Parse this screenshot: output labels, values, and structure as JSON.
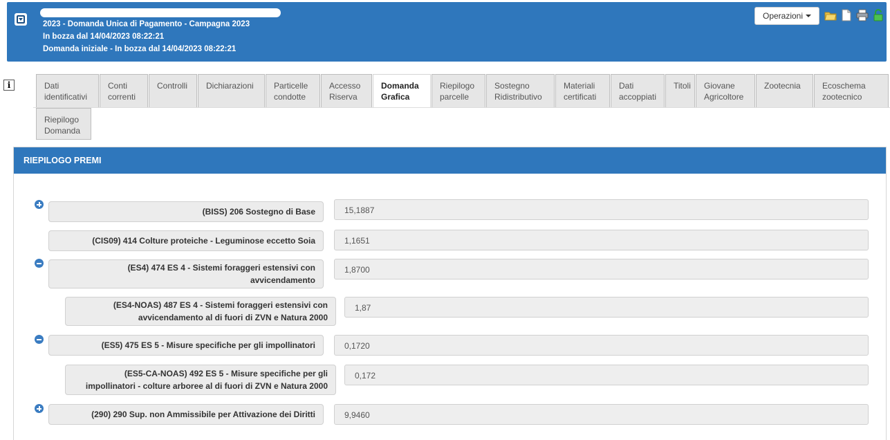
{
  "header": {
    "title": "2023 - Domanda Unica di Pagamento - Campagna 2023",
    "status": "In bozza dal 14/04/2023 08:22:21",
    "detail": "Domanda iniziale - In bozza dal 14/04/2023 08:22:21",
    "operations_label": "Operazioni",
    "icons": [
      "folder-icon",
      "document-icon",
      "print-icon",
      "unlock-icon"
    ]
  },
  "tabs": [
    {
      "line1": "Dati",
      "line2": "identificativi"
    },
    {
      "line1": "Conti",
      "line2": "correnti"
    },
    {
      "line1": "Controlli",
      "line2": ""
    },
    {
      "line1": "Dichiarazioni",
      "line2": ""
    },
    {
      "line1": "Particelle",
      "line2": "condotte"
    },
    {
      "line1": "Accesso",
      "line2": "Riserva"
    },
    {
      "line1": "Domanda",
      "line2": "Grafica"
    },
    {
      "line1": "Riepilogo",
      "line2": "parcelle"
    },
    {
      "line1": "Sostegno",
      "line2": "Ridistributivo"
    },
    {
      "line1": "Materiali",
      "line2": "certificati"
    },
    {
      "line1": "Dati",
      "line2": "accoppiati"
    },
    {
      "line1": "Titoli",
      "line2": ""
    },
    {
      "line1": "Giovane",
      "line2": "Agricoltore"
    },
    {
      "line1": "Zootecnia",
      "line2": ""
    },
    {
      "line1": "Ecoschema",
      "line2": "zootecnico"
    },
    {
      "line1": "Riepilogo",
      "line2": "Domanda"
    }
  ],
  "active_tab": "Domanda Grafica",
  "panel": {
    "title": "RIEPILOGO PREMI",
    "rows": [
      {
        "label": "(BISS) 206 Sostegno di Base",
        "value": "15,1887",
        "expander": "plus"
      },
      {
        "label": "(CIS09) 414 Colture proteiche - Leguminose eccetto Soia",
        "value": "1,1651",
        "expander": ""
      },
      {
        "label": "(ES4) 474 ES 4 - Sistemi foraggeri estensivi con avvicendamento",
        "value": "1,8700",
        "expander": "minus"
      },
      {
        "label": "(ES4-NOAS) 487 ES 4 - Sistemi foraggeri estensivi con avvicendamento al di fuori di ZVN e Natura 2000",
        "value": "1,87",
        "expander": ""
      },
      {
        "label": "(ES5) 475 ES 5 - Misure specifiche per gli impollinatori",
        "value": "0,1720",
        "expander": "minus"
      },
      {
        "label": "(ES5-CA-NOAS) 492 ES 5 - Misure specifiche per gli impollinatori - colture arboree al di fuori di ZVN e Natura 2000",
        "value": "0,172",
        "expander": ""
      },
      {
        "label": "(290) 290 Sup. non Ammissibile per Attivazione dei Diritti",
        "value": "9,9460",
        "expander": "plus"
      }
    ]
  }
}
